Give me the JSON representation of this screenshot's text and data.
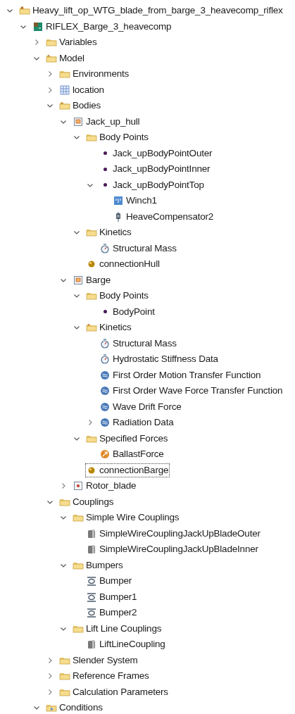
{
  "tree": [
    {
      "label": "Heavy_lift_op_WTG_blade_from_barge_3_heavecomp_riflex",
      "kind": "project",
      "expanded": true,
      "selected": false,
      "children": [
        {
          "label": "RIFLEX_Barge_3_heavecomp",
          "kind": "riflex",
          "expanded": true,
          "selected": false,
          "children": [
            {
              "label": "Variables",
              "kind": "folder",
              "expanded": false,
              "selected": false
            },
            {
              "label": "Model",
              "kind": "folder_special",
              "expanded": true,
              "selected": false,
              "children": [
                {
                  "label": "Environments",
                  "kind": "folder",
                  "expanded": false,
                  "selected": false
                },
                {
                  "label": "location",
                  "kind": "grid",
                  "expanded": false,
                  "selected": false
                },
                {
                  "label": "Bodies",
                  "kind": "folder_special",
                  "expanded": true,
                  "selected": false,
                  "children": [
                    {
                      "label": "Jack_up_hull",
                      "kind": "body",
                      "expanded": true,
                      "selected": false,
                      "children": [
                        {
                          "label": "Body Points",
                          "kind": "folder",
                          "expanded": true,
                          "selected": false,
                          "children": [
                            {
                              "label": "Jack_upBodyPointOuter",
                              "kind": "point",
                              "selected": false
                            },
                            {
                              "label": "Jack_upBodyPointInner",
                              "kind": "point",
                              "selected": false
                            },
                            {
                              "label": "Jack_upBodyPointTop",
                              "kind": "point",
                              "expanded": true,
                              "selected": false,
                              "children": [
                                {
                                  "label": "Winch1",
                                  "kind": "winch",
                                  "selected": false
                                },
                                {
                                  "label": "HeaveCompensator2",
                                  "kind": "compensator",
                                  "selected": false
                                }
                              ]
                            }
                          ]
                        },
                        {
                          "label": "Kinetics",
                          "kind": "folder",
                          "expanded": true,
                          "selected": false,
                          "children": [
                            {
                              "label": "Structural Mass",
                              "kind": "mass",
                              "selected": false
                            }
                          ]
                        },
                        {
                          "label": "connectionHull",
                          "kind": "connection",
                          "selected": false
                        }
                      ]
                    },
                    {
                      "label": "Barge",
                      "kind": "body",
                      "expanded": true,
                      "selected": false,
                      "children": [
                        {
                          "label": "Body Points",
                          "kind": "folder",
                          "expanded": true,
                          "selected": false,
                          "children": [
                            {
                              "label": "BodyPoint",
                              "kind": "point",
                              "selected": false
                            }
                          ]
                        },
                        {
                          "label": "Kinetics",
                          "kind": "folder_special",
                          "expanded": true,
                          "selected": false,
                          "children": [
                            {
                              "label": "Structural Mass",
                              "kind": "mass",
                              "selected": false
                            },
                            {
                              "label": "Hydrostatic Stiffness Data",
                              "kind": "mass",
                              "selected": false
                            },
                            {
                              "label": "First Order Motion Transfer Function",
                              "kind": "wave",
                              "selected": false
                            },
                            {
                              "label": "First Order Wave Force Transfer Function",
                              "kind": "wave",
                              "selected": false
                            },
                            {
                              "label": "Wave Drift Force",
                              "kind": "wave",
                              "selected": false
                            },
                            {
                              "label": "Radiation Data",
                              "kind": "wave",
                              "expanded": false,
                              "selected": false
                            }
                          ]
                        },
                        {
                          "label": "Specified Forces",
                          "kind": "folder",
                          "expanded": true,
                          "selected": false,
                          "children": [
                            {
                              "label": "BallastForce",
                              "kind": "force",
                              "selected": false
                            }
                          ]
                        },
                        {
                          "label": "connectionBarge",
                          "kind": "connection",
                          "selected": true
                        }
                      ]
                    },
                    {
                      "label": "Rotor_blade",
                      "kind": "rotor",
                      "expanded": false,
                      "selected": false
                    }
                  ]
                },
                {
                  "label": "Couplings",
                  "kind": "folder",
                  "expanded": true,
                  "selected": false,
                  "children": [
                    {
                      "label": "Simple Wire Couplings",
                      "kind": "folder",
                      "expanded": true,
                      "selected": false,
                      "children": [
                        {
                          "label": "SimpleWireCouplingJackUpBladeOuter",
                          "kind": "coupling",
                          "selected": false
                        },
                        {
                          "label": "SimpleWireCouplingJackUpBladeInner",
                          "kind": "coupling",
                          "selected": false
                        }
                      ]
                    },
                    {
                      "label": "Bumpers",
                      "kind": "folder",
                      "expanded": true,
                      "selected": false,
                      "children": [
                        {
                          "label": "Bumper",
                          "kind": "bumper",
                          "selected": false
                        },
                        {
                          "label": "Bumper1",
                          "kind": "bumper",
                          "selected": false
                        },
                        {
                          "label": "Bumper2",
                          "kind": "bumper",
                          "selected": false
                        }
                      ]
                    },
                    {
                      "label": "Lift Line Couplings",
                      "kind": "folder",
                      "expanded": true,
                      "selected": false,
                      "children": [
                        {
                          "label": "LiftLineCoupling",
                          "kind": "coupling",
                          "selected": false
                        }
                      ]
                    }
                  ]
                },
                {
                  "label": "Slender System",
                  "kind": "folder",
                  "expanded": false,
                  "selected": false
                },
                {
                  "label": "Reference Frames",
                  "kind": "folder",
                  "expanded": false,
                  "selected": false
                },
                {
                  "label": "Calculation Parameters",
                  "kind": "folder",
                  "expanded": false,
                  "selected": false
                }
              ]
            },
            {
              "label": "Conditions",
              "kind": "conditions",
              "expanded": true,
              "selected": false
            }
          ]
        }
      ]
    }
  ]
}
